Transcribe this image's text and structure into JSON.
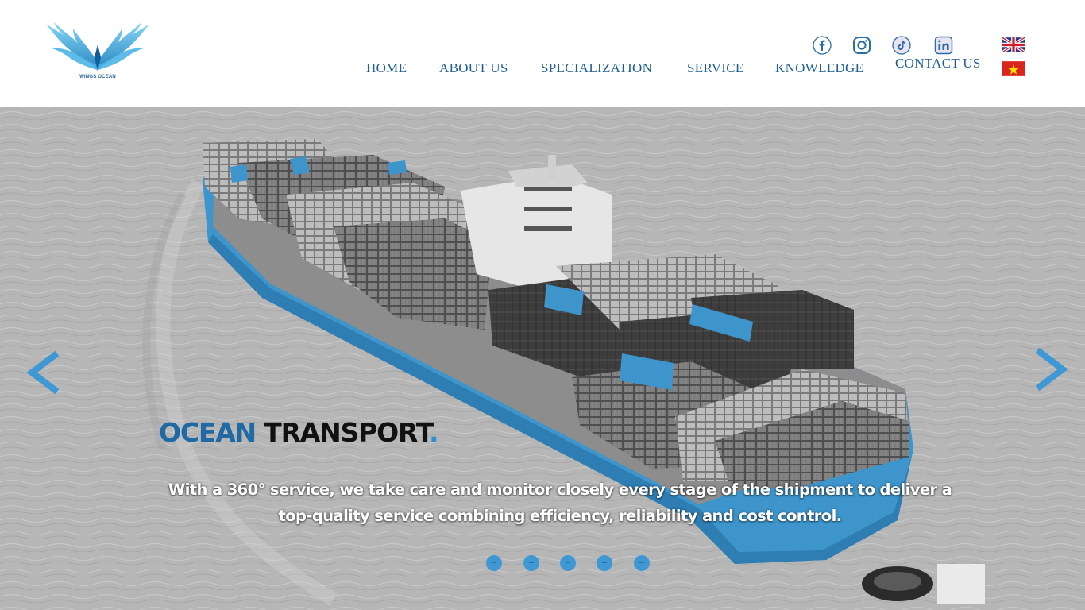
{
  "brand": {
    "name": "WINGS OCEAN",
    "logo_icon": "wings-logo-icon",
    "accent_color": "#2f8fd0"
  },
  "nav": {
    "items": [
      {
        "label": "HOME"
      },
      {
        "label": "ABOUT US"
      },
      {
        "label": "SPECIALIZATION"
      },
      {
        "label": "SERVICE"
      },
      {
        "label": "KNOWLEDGE"
      },
      {
        "label": "CONTACT US"
      }
    ]
  },
  "social": [
    "facebook-icon",
    "instagram-icon",
    "tiktok-icon",
    "linkedin-icon"
  ],
  "languages": [
    "uk-flag-icon",
    "vietnam-flag-icon"
  ],
  "hero": {
    "title_part1": "OCEAN",
    "title_part2": "TRANSPORT",
    "title_dot": ".",
    "subtitle_line1": "With a 360° service, we take care and monitor closely every stage of the shipment to deliver a",
    "subtitle_line2": "top-quality service combining efficiency, reliability and cost control.",
    "prev_icon": "chevron-left-icon",
    "next_icon": "chevron-right-icon",
    "slide_count": 5,
    "active_slide": 1
  }
}
